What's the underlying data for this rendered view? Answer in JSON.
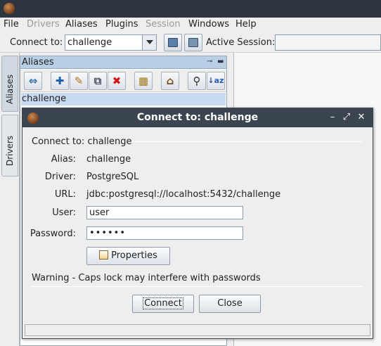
{
  "menubar": {
    "items": [
      {
        "label": "File",
        "enabled": true
      },
      {
        "label": "Drivers",
        "enabled": false
      },
      {
        "label": "Aliases",
        "enabled": true
      },
      {
        "label": "Plugins",
        "enabled": true
      },
      {
        "label": "Session",
        "enabled": false
      },
      {
        "label": "Windows",
        "enabled": true
      },
      {
        "label": "Help",
        "enabled": true
      }
    ]
  },
  "toolbar": {
    "connect_to_label": "Connect to:",
    "connect_to_value": "challenge",
    "active_session_label": "Active Session:",
    "active_session_value": ""
  },
  "side_tabs": {
    "aliases": "Aliases",
    "drivers": "Drivers"
  },
  "aliases_panel": {
    "title": "Aliases",
    "items": [
      "challenge"
    ]
  },
  "dialog": {
    "title": "Connect to: challenge",
    "section_label": "Connect to: challenge",
    "alias_label": "Alias:",
    "alias_value": "challenge",
    "driver_label": "Driver:",
    "driver_value": "PostgreSQL",
    "url_label": "URL:",
    "url_value": "jdbc:postgresql://localhost:5432/challenge",
    "user_label": "User:",
    "user_value": "user",
    "password_label": "Password:",
    "password_value": "••••••",
    "properties_button": "Properties",
    "warning": "Warning - Caps lock may interfere with passwords",
    "connect_button": "Connect",
    "close_button": "Close",
    "window_controls": {
      "minimize": "–",
      "maximize": "⤢",
      "close": "✕"
    }
  },
  "colors": {
    "titlebar": "#2d3640",
    "panel_header": "#b8cfe5",
    "selection": "#c7daf0"
  }
}
